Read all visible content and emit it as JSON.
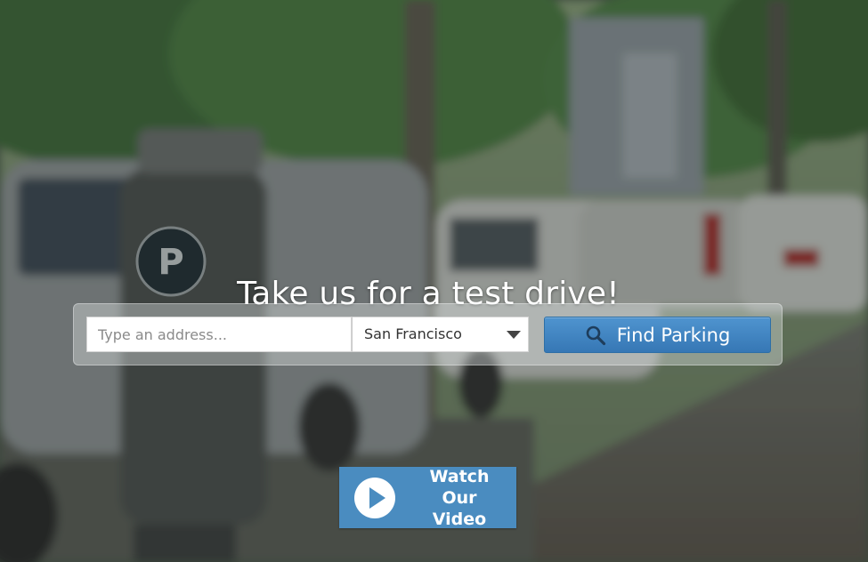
{
  "hero": {
    "headline": "Take us for a test drive!"
  },
  "search": {
    "address_placeholder": "Type an address...",
    "address_value": "",
    "city_selected": "San Francisco",
    "find_button_label": "Find Parking"
  },
  "video": {
    "label_line1": "Watch Our",
    "label_line2": "Video"
  },
  "icons": {
    "search": "search-icon",
    "play": "play-icon",
    "dropdown": "caret-down-icon",
    "parking_meter": "parking-icon"
  },
  "colors": {
    "button_blue": "#4a8cc0",
    "find_button": "#3f84c2",
    "headline_text": "#ffffff"
  }
}
